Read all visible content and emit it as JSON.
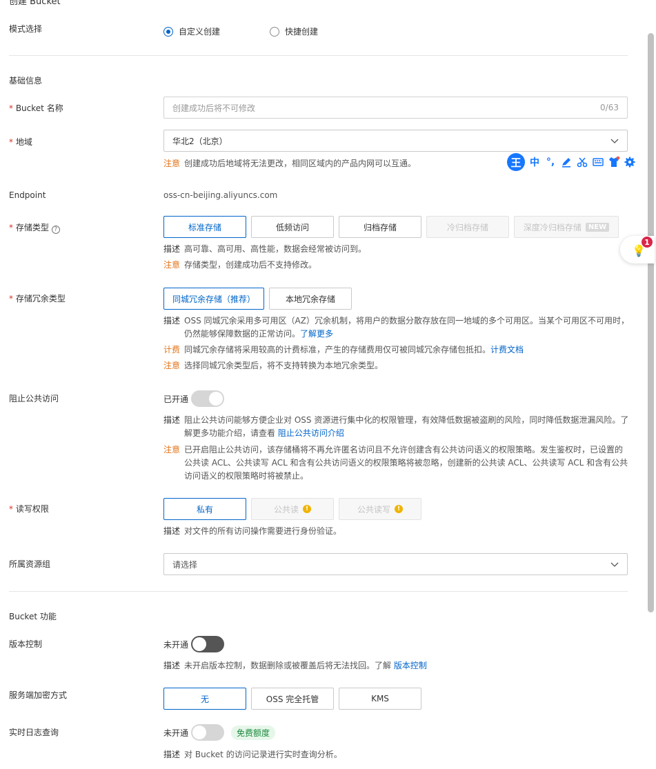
{
  "page": {
    "title": "创建 Bucket"
  },
  "mode": {
    "label": "模式选择",
    "options": [
      "自定义创建",
      "快捷创建"
    ],
    "selected": "自定义创建"
  },
  "basic": {
    "title": "基础信息",
    "bucket_name": {
      "label": "Bucket 名称",
      "placeholder": "创建成功后将不可修改",
      "count": "0/63"
    },
    "region": {
      "label": "地域",
      "value": "华北2（北京）",
      "note_key": "注意",
      "note": "创建成功后地域将无法更改，相同区域内的产品内网可以互通。"
    },
    "endpoint": {
      "label": "Endpoint",
      "value": "oss-cn-beijing.aliyuncs.com"
    },
    "storage_class": {
      "label": "存储类型",
      "options": [
        "标准存储",
        "低频访问",
        "归档存储",
        "冷归档存储",
        "深度冷归档存储"
      ],
      "new_tag": "NEW",
      "desc_key": "描述",
      "desc": "高可靠、高可用、高性能，数据会经常被访问到。",
      "note_key": "注意",
      "note": "存储类型，创建成功后不支持修改。"
    },
    "redundancy": {
      "label": "存储冗余类型",
      "options": [
        "同城冗余存储（推荐）",
        "本地冗余存储"
      ],
      "desc_key": "描述",
      "desc": "OSS 同城冗余采用多可用区（AZ）冗余机制，将用户的数据分散存放在同一地域的多个可用区。当某个可用区不可用时，仍然能够保障数据的正常访问。",
      "desc_link": "了解更多",
      "fee_key": "计费",
      "fee": "同城冗余存储将采用较高的计费标准，产生的存储费用仅可被同城冗余存储包抵扣。",
      "fee_link": "计费文档",
      "note_key": "注意",
      "note": "选择同城冗余类型后，将不支持转换为本地冗余类型。"
    },
    "block_public": {
      "label": "阻止公共访问",
      "state": "已开通",
      "desc_key": "描述",
      "desc": "阻止公共访问能够方便企业对 OSS 资源进行集中化的权限管理，有效降低数据被盗刷的风险，同时降低数据泄漏风险。了解更多功能介绍，请查看",
      "desc_link": "阻止公共访问介绍",
      "note_key": "注意",
      "note": "已开启阻止公共访问，该存储桶将不再允许匿名访问且不允许创建含有公共访问语义的权限策略。发生鉴权时，已设置的公共读 ACL、公共读写 ACL 和含有公共访问语义的权限策略将被忽略，创建新的公共读 ACL、公共读写 ACL 和含有公共访问语义的权限策略时将被禁止。"
    },
    "acl": {
      "label": "读写权限",
      "options": [
        "私有",
        "公共读",
        "公共读写"
      ],
      "desc_key": "描述",
      "desc": "对文件的所有访问操作需要进行身份验证。"
    },
    "resource_group": {
      "label": "所属资源组",
      "placeholder": "请选择"
    }
  },
  "features": {
    "title": "Bucket 功能",
    "versioning": {
      "label": "版本控制",
      "state": "未开通",
      "desc_key": "描述",
      "desc": "未开启版本控制，数据删除或被覆盖后将无法找回。了解",
      "desc_link": "版本控制"
    },
    "encryption": {
      "label": "服务端加密方式",
      "options": [
        "无",
        "OSS 完全托管",
        "KMS"
      ]
    },
    "realtime_log": {
      "label": "实时日志查询",
      "state": "未开通",
      "tag": "免费额度",
      "desc_key": "描述",
      "desc": "对 Bucket 的访问记录进行实时查询分析。"
    }
  },
  "ime_toolbar": {
    "logo": "王",
    "lang": "中",
    "punct": "°,"
  },
  "colors": {
    "primary": "#0064c8",
    "required": "#d93026",
    "note": "#e37318",
    "free_tag_bg": "#e6f7ea"
  }
}
